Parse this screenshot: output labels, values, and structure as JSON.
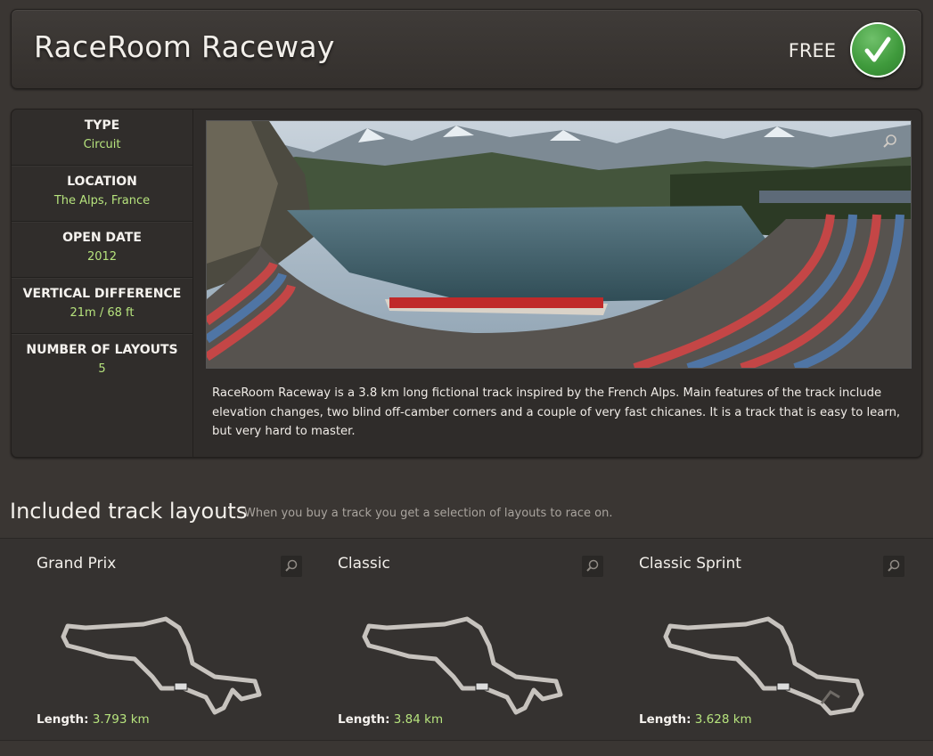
{
  "header": {
    "title": "RaceRoom Raceway",
    "price_label": "FREE",
    "status_icon": "checkmark-icon",
    "accent": "#3f9a3c"
  },
  "specs": [
    {
      "label": "TYPE",
      "value": "Circuit"
    },
    {
      "label": "LOCATION",
      "value": "The Alps, France"
    },
    {
      "label": "OPEN DATE",
      "value": "2012"
    },
    {
      "label": "VERTICAL DIFFERENCE",
      "value": "21m / 68 ft"
    },
    {
      "label": "NUMBER OF LAYOUTS",
      "value": "5"
    }
  ],
  "description": "RaceRoom Raceway is a 3.8 km long fictional track inspired by the French Alps. Main features of the track include elevation changes, two blind off-camber corners and a couple of very fast chicanes. It is a track that is easy to learn, but very hard to master.",
  "layouts_section": {
    "title": "Included track layouts",
    "subtitle": "When you buy a track you get a selection of layouts to race on."
  },
  "layouts": [
    {
      "name": "Grand Prix",
      "length_label": "Length:",
      "length": "3.793 km"
    },
    {
      "name": "Classic",
      "length_label": "Length:",
      "length": "3.84 km"
    },
    {
      "name": "Classic Sprint",
      "length_label": "Length:",
      "length": "3.628 km"
    }
  ],
  "colors": {
    "value_green": "#b6e37d",
    "background": "#3a3633"
  }
}
